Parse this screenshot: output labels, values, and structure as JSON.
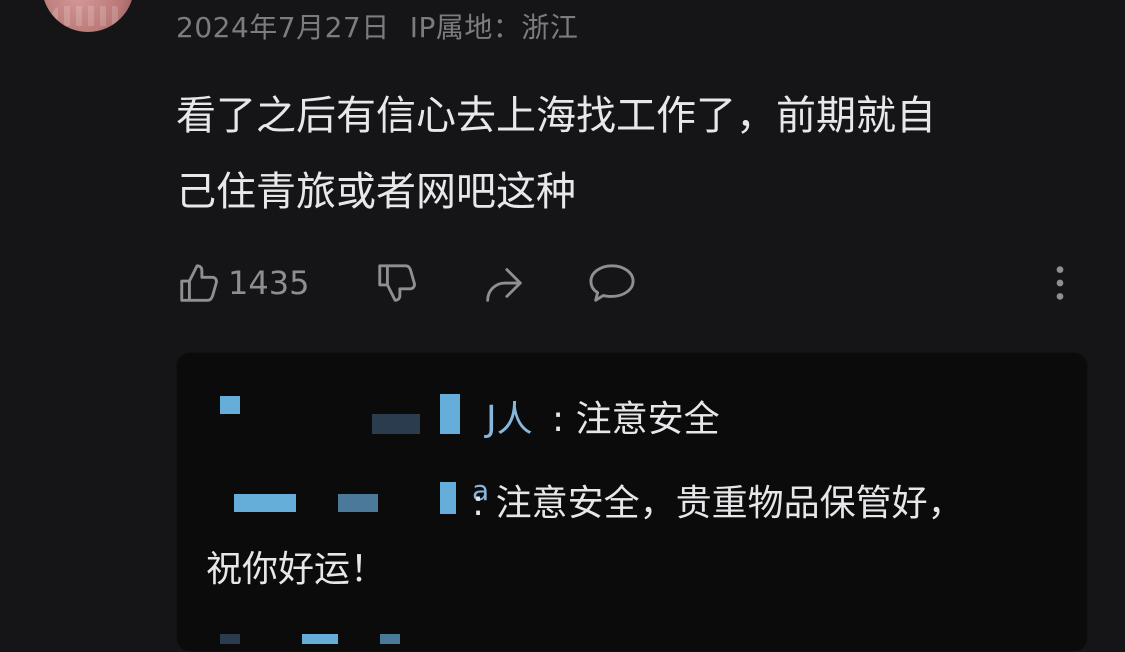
{
  "header": {
    "date": "2024年7月27日",
    "ip_label": "IP属地：浙江"
  },
  "comment": {
    "line1": "看了之后有信心去上海找工作了，前期就自",
    "line2": "己住青旅或者网吧这种"
  },
  "actions": {
    "like_count": "1435",
    "icons": [
      "thumb-up-icon",
      "thumb-down-icon",
      "share-icon",
      "comment-icon",
      "more-icon"
    ]
  },
  "replies": [
    {
      "name_fragment": "J人",
      "text": ": 注意安全"
    },
    {
      "name_fragment": "a",
      "text": ": 注意安全，贵重物品保管好，",
      "continued": "祝你好运！"
    }
  ],
  "colors": {
    "background": "#151517",
    "panel": "#0b0b0c",
    "meta_text": "#7c7c80",
    "comment_text": "#e8e8ea",
    "mosaic_blue": "#6bb7e6"
  }
}
